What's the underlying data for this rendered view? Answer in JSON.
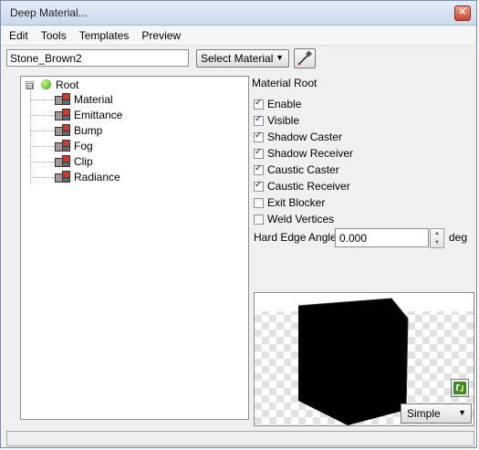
{
  "window": {
    "title": "Deep Material...",
    "close_icon": "close-icon"
  },
  "menu": [
    "Edit",
    "Tools",
    "Templates",
    "Preview"
  ],
  "toolbar": {
    "material_name": "Stone_Brown2",
    "select_material_label": "Select Material",
    "select_arrow": "▼",
    "picker_icon": "eyedropper-icon"
  },
  "tree": {
    "root": {
      "label": "Root",
      "expander": "⊟",
      "icon": "green-sphere-icon"
    },
    "children": [
      "Material",
      "Emittance",
      "Bump",
      "Fog",
      "Clip",
      "Radiance"
    ],
    "child_icon": "shader-node-icon"
  },
  "panel": {
    "title": "Material Root",
    "checkboxes": [
      {
        "label": "Enable",
        "checked": true
      },
      {
        "label": "Visible",
        "checked": true
      },
      {
        "label": "Shadow Caster",
        "checked": true
      },
      {
        "label": "Shadow Receiver",
        "checked": true
      },
      {
        "label": "Caustic Caster",
        "checked": true
      },
      {
        "label": "Caustic Receiver",
        "checked": true
      },
      {
        "label": "Exit Blocker",
        "checked": false
      },
      {
        "label": "Weld Vertices",
        "checked": false
      }
    ],
    "hard_edge_label": "Hard Edge Angle:",
    "hard_edge_value": "0.000",
    "hard_edge_unit": "deg"
  },
  "preview": {
    "mode": "Simple",
    "mode_arrow": "▼",
    "refresh_icon": "refresh-arrows-icon",
    "object_color": "#000000",
    "floor": "checkerboard"
  },
  "colors": {
    "title_bar": "#cad9ec",
    "background": "#f0f0f0",
    "root_icon": "#3a9a10",
    "node_icon": "#c83028"
  }
}
